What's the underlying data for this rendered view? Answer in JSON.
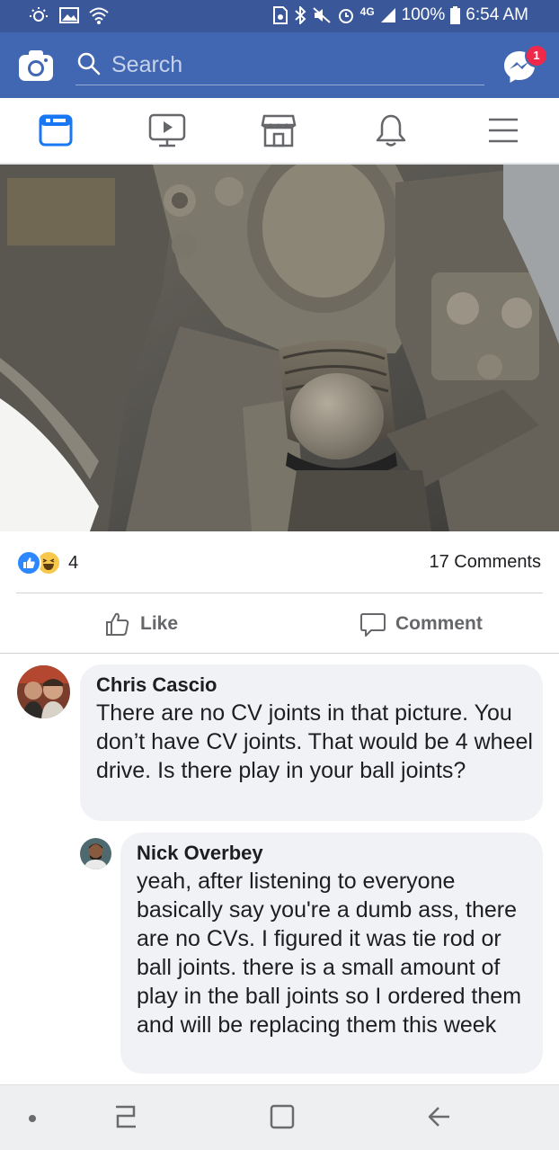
{
  "status_bar": {
    "network": "4G",
    "battery": "100%",
    "time": "6:54 AM"
  },
  "top_bar": {
    "search_placeholder": "Search",
    "messenger_badge": "1",
    "brand_color": "#4267b2"
  },
  "tabs": [
    {
      "icon": "news-feed-icon",
      "active": true
    },
    {
      "icon": "watch-icon",
      "active": false
    },
    {
      "icon": "marketplace-icon",
      "active": false
    },
    {
      "icon": "notifications-bell-icon",
      "active": false
    },
    {
      "icon": "menu-icon",
      "active": false
    }
  ],
  "post": {
    "reaction_count": "4",
    "comments_count": "17 Comments",
    "like_label": "Like",
    "comment_label": "Comment"
  },
  "comments": [
    {
      "author": "Chris Cascio",
      "text": "There are no CV joints in that picture. You don’t have CV joints. That would be 4 wheel drive. Is there play in your ball joints?"
    },
    {
      "author": "Nick Overbey",
      "text": "yeah, after listening to everyone basically say you're a dumb ass, there are no CVs. I figured it was tie rod or ball joints. there is a small amount of play in the ball joints so I ordered them and will be replacing them this week"
    }
  ]
}
